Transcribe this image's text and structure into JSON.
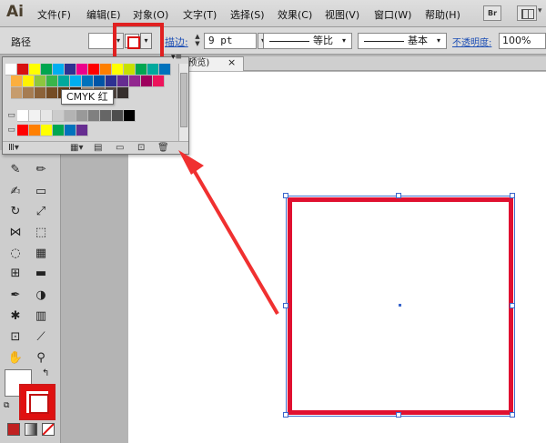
{
  "app": {
    "logo": "Ai"
  },
  "menu": [
    "文件(F)",
    "编辑(E)",
    "对象(O)",
    "文字(T)",
    "选择(S)",
    "效果(C)",
    "视图(V)",
    "窗口(W)",
    "帮助(H)"
  ],
  "menu_right": {
    "bridge_label": "Br"
  },
  "control": {
    "object_type": "路径",
    "stroke_label": "描边:",
    "stroke_weight": "9 pt",
    "profile_label": "等比",
    "brush_label": "基本",
    "opacity_label": "不透明度:",
    "opacity_value": "100%"
  },
  "document_tab": {
    "title": "/预览)",
    "close": "×"
  },
  "swatches_panel": {
    "tooltip": "CMYK 红",
    "rows": [
      [
        "#ffffff",
        "#d81010",
        "#ffff00",
        "#00a650",
        "#00aeef",
        "#2e3192",
        "#ec008c",
        "#ff0000",
        "#ff7f00",
        "#ffff00",
        "#c7e000",
        "#00a651",
        "#00a99d",
        "#0072bc",
        "#2e3192",
        "#662d91",
        "#92278f",
        "#ec008c",
        "#ed145b",
        "#f26522"
      ],
      [
        "#fbaf3f",
        "#fff200",
        "#8dc63f",
        "#39b54a",
        "#00a99d",
        "#00aeef",
        "#0072bc",
        "#0054a6",
        "#2e3192",
        "#662d91",
        "#92278f",
        "#9e005d",
        "#ed145b",
        "#f26522"
      ],
      [
        "#c69c6d",
        "#a67c52",
        "#8c6239",
        "#754c24",
        "#603913",
        "#3c2415",
        "#998675",
        "#736357",
        "#534741",
        "#362f2d"
      ],
      [
        "#ffffff",
        "#f2f2f2",
        "#e6e6e6",
        "#cccccc",
        "#b3b3b3",
        "#999999",
        "#808080",
        "#666666",
        "#4d4d4d",
        "#000000"
      ],
      [
        "#ff0000",
        "#ff7f00",
        "#ffff00",
        "#00a651",
        "#0072bc",
        "#662d91"
      ]
    ]
  },
  "colors": {
    "accent_red": "#e01030",
    "selection_blue": "#3a66cc",
    "ui_gray": "#cdcdcd"
  }
}
